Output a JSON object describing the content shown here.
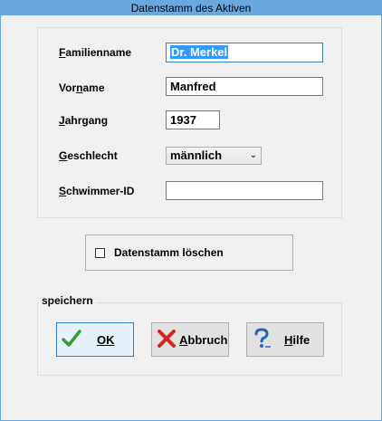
{
  "window": {
    "title": "Datenstamm des Aktiven"
  },
  "form": {
    "familienname": {
      "label_u": "F",
      "label_rest": "amilienname",
      "value": "Dr. Merkel"
    },
    "vorname": {
      "label_pre": "Vor",
      "label_u": "n",
      "label_rest": "ame",
      "value": "Manfred"
    },
    "jahrgang": {
      "label_u": "J",
      "label_rest": "ahrgang",
      "value": "1937"
    },
    "geschlecht": {
      "label_u": "G",
      "label_rest": "eschlecht",
      "value": "männlich"
    },
    "schwimmer_id": {
      "label_u": "S",
      "label_rest": "chwimmer-ID",
      "value": ""
    }
  },
  "checkbox": {
    "label": "Datenstamm löschen",
    "checked": false
  },
  "group": {
    "legend": "speichern"
  },
  "buttons": {
    "ok": {
      "label": "OK",
      "icon": "checkmark-icon"
    },
    "cancel": {
      "label_u": "A",
      "label_rest": "bbruch",
      "icon": "red-x-icon"
    },
    "help": {
      "label_u": "H",
      "label_rest": "ilfe",
      "icon": "help-question-icon"
    }
  },
  "colors": {
    "titlebar": "#6aa7e0",
    "selection": "#3399ff",
    "check_green": "#3a9a2a",
    "cancel_red": "#d3261e",
    "help_blue": "#2a63b8"
  }
}
